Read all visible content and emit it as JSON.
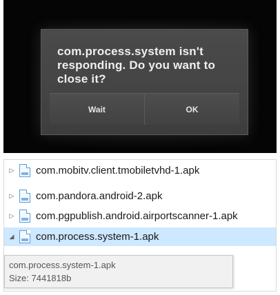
{
  "dialog": {
    "message": "com.process.system isn't responding. Do you want to close it?",
    "buttons": [
      {
        "label": "Wait"
      },
      {
        "label": "OK"
      }
    ]
  },
  "explorer": {
    "items": [
      {
        "name": "com.mobitv.client.tmobiletvhd-1.apk",
        "expander": "▷",
        "selected": false
      },
      {
        "name": "com.pandora.android-2.apk",
        "expander": "▷",
        "selected": false
      },
      {
        "name": "com.pgpublish.android.airportscanner-1.apk",
        "expander": "▷",
        "selected": false
      },
      {
        "name": "com.process.system-1.apk",
        "expander": "◢",
        "selected": true
      }
    ]
  },
  "tooltip": {
    "name": "com.process.system-1.apk",
    "size": "Size: 7441818b"
  },
  "colors": {
    "selection": "#cde8ff",
    "file_icon": "#5b9bd5",
    "dialog_bg": "#444444"
  }
}
